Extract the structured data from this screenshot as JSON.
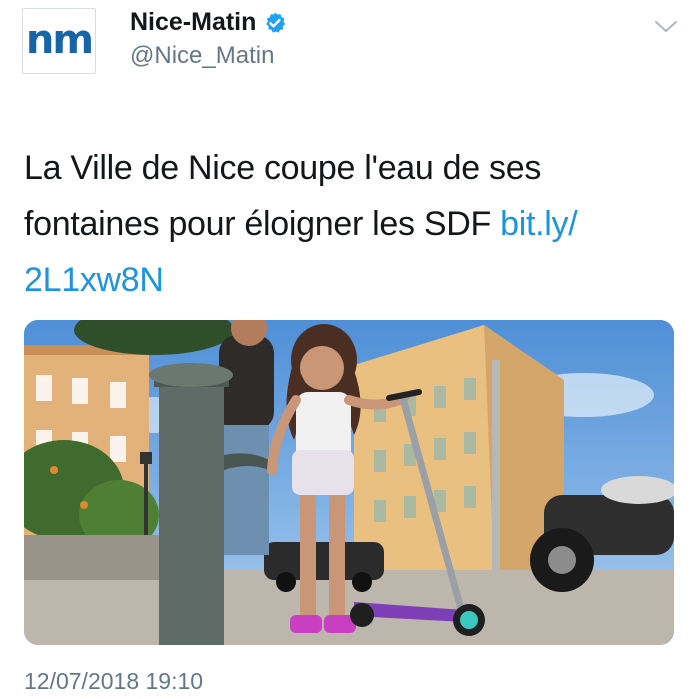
{
  "account": {
    "avatar_text": "nm",
    "display_name": "Nice-Matin",
    "handle": "@Nice_Matin",
    "verified": true
  },
  "tweet": {
    "text_before_link": "La Ville de Nice coupe l'eau de ses fontaines pour éloigner les SDF ",
    "link_text": "bit.ly/ 2L1xw8N",
    "timestamp": "12/07/2018 19:10"
  },
  "icons": {
    "verified": "verified-badge-icon",
    "menu": "chevron-down-icon"
  },
  "colors": {
    "link": "#1b95e0",
    "verified": "#1da1f2",
    "secondary_text": "#657786",
    "avatar_brand": "#1565a8"
  }
}
